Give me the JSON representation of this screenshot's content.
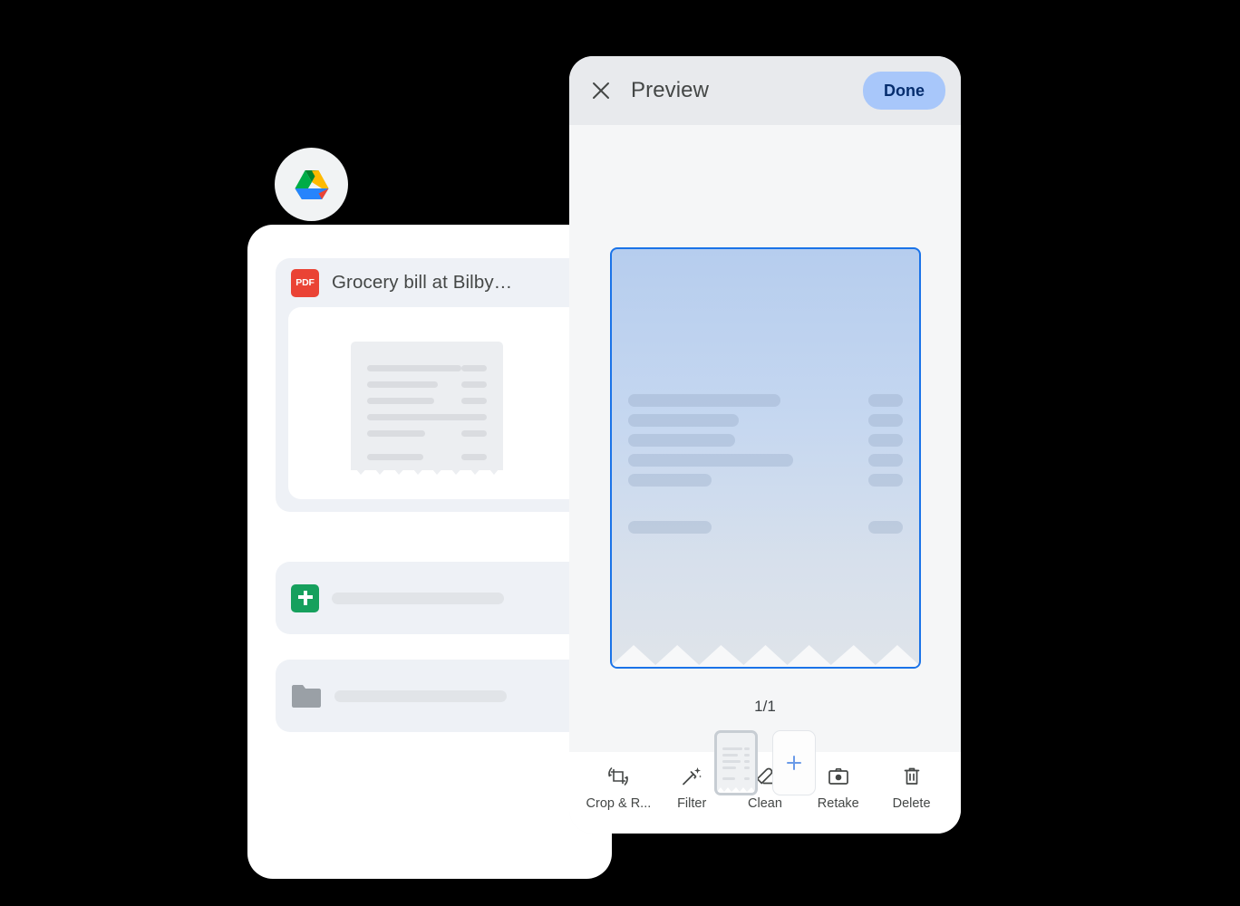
{
  "theme": {
    "page_background": "#000000",
    "card_background": "#ffffff",
    "phone_background": "#f5f6f7",
    "header_background": "#e8eaed",
    "accent_blue": "#1a73e8",
    "done_button_fill": "#a8c7fa",
    "done_button_text": "#062e6f",
    "pdf_red": "#ea4335",
    "sheets_green": "#16a05d",
    "folder_gray": "#9aa0a6",
    "row_background": "#eef1f6"
  },
  "drive_badge": {
    "icon": "google-drive-logo",
    "colors": {
      "blue": "#1a73e8",
      "green": "#00ac47",
      "yellow": "#ffba00",
      "red": "#ea4335",
      "dark_green": "#00832d",
      "dark_yellow": "#ffba00"
    }
  },
  "files_card": {
    "pdf_item": {
      "icon": "pdf-file-icon",
      "icon_label": "PDF",
      "title": "Grocery bill at Bilby…",
      "menu_icon": "more-vertical-icon",
      "thumbnail": {
        "icon": "receipt-thumbnail",
        "status_icon": "loading-spinner",
        "line_widths": [
          104,
          78,
          74,
          118,
          64
        ],
        "amount_widths": [
          28,
          28,
          28,
          28,
          28
        ],
        "footer_line_width": 62,
        "footer_amount_width": 28
      }
    },
    "rows": [
      {
        "icon": "sheets-file-icon",
        "title_placeholder": "",
        "menu_icon": "more-vertical-icon"
      },
      {
        "icon": "folder-icon",
        "title_placeholder": "",
        "menu_icon": "more-vertical-icon"
      }
    ]
  },
  "preview": {
    "header": {
      "close_icon": "close-icon",
      "title": "Preview",
      "done_label": "Done"
    },
    "document": {
      "icon": "document-preview",
      "selected": true,
      "line_widths": [
        168,
        122,
        118,
        182,
        92
      ],
      "amount_widths": [
        38,
        38,
        38,
        38,
        38
      ],
      "footer_line_width": 92,
      "footer_amount_width": 38
    },
    "page_indicator": "1/1",
    "thumbnails": [
      {
        "icon": "page-thumbnail-receipt",
        "selected": true
      }
    ],
    "add_page": {
      "icon": "plus-icon",
      "label": "+"
    },
    "toolbar": [
      {
        "icon": "crop-rotate-icon",
        "label": "Crop & R..."
      },
      {
        "icon": "magic-wand-filter-icon",
        "label": "Filter"
      },
      {
        "icon": "eraser-clean-icon",
        "label": "Clean"
      },
      {
        "icon": "camera-retake-icon",
        "label": "Retake"
      },
      {
        "icon": "trash-delete-icon",
        "label": "Delete"
      }
    ]
  }
}
